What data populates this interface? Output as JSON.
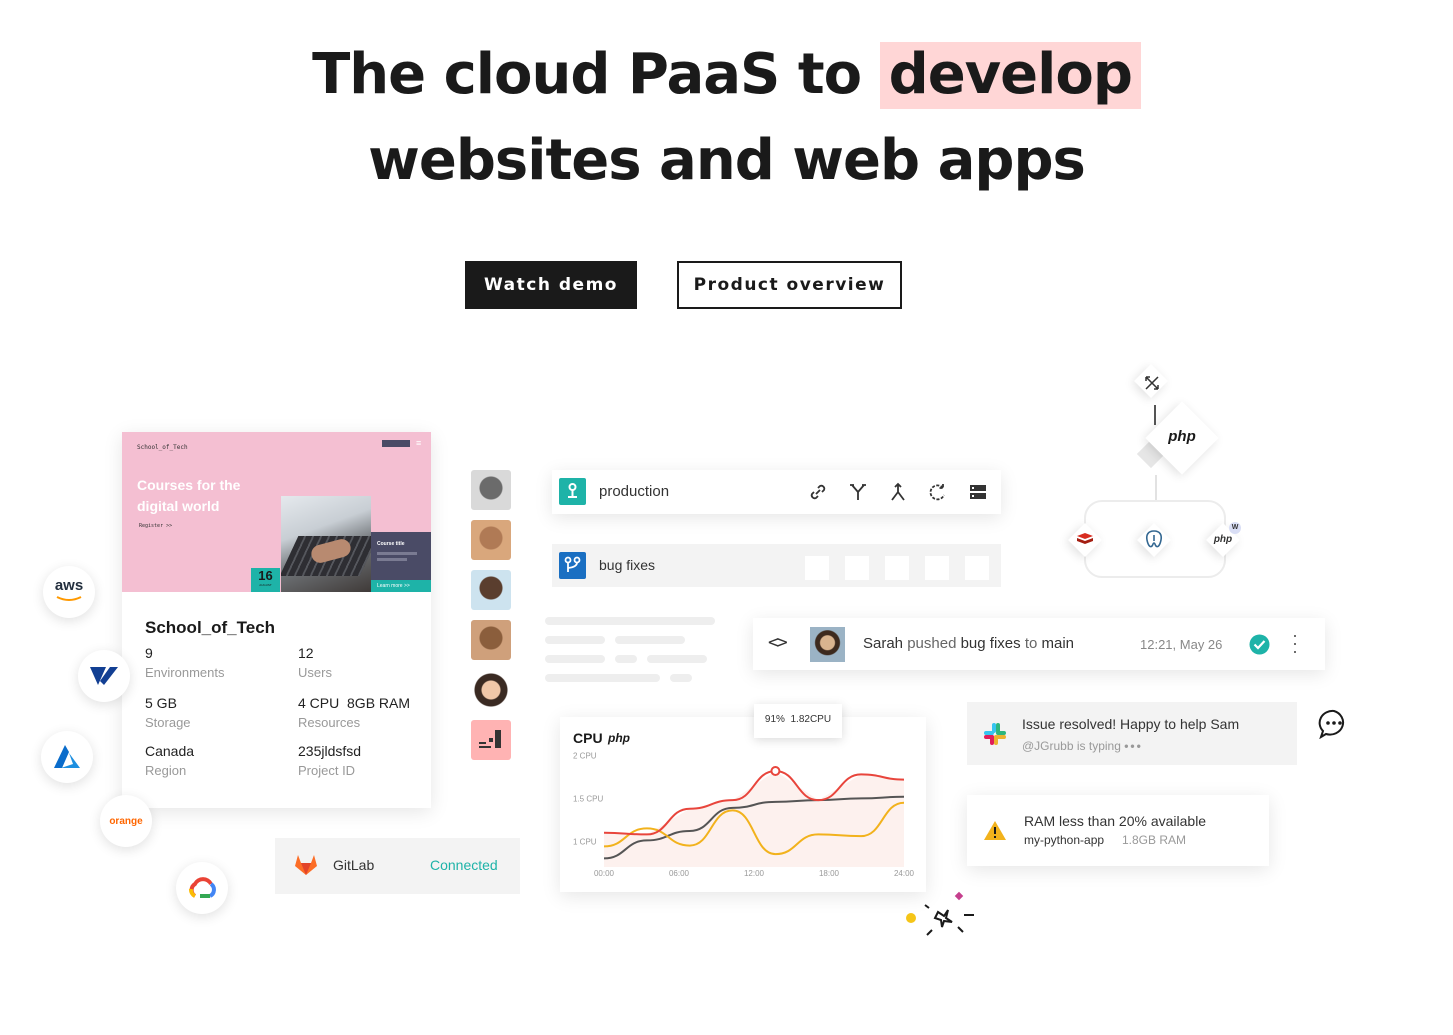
{
  "hero": {
    "line1_prefix": "The cloud PaaS to",
    "line1_highlight": "develop",
    "line2": "websites and web apps"
  },
  "buttons": {
    "watch_demo": "Watch demo",
    "product_overview": "Product overview"
  },
  "project_card": {
    "site_brand": "School_of_Tech",
    "site_headline_1": "Courses for the",
    "site_headline_2": "digital world",
    "site_register": "Register >>",
    "date_day": "16",
    "date_month": "AUGUST",
    "course_title": "Course title",
    "learn_more": "Learn more >>",
    "name": "School_of_Tech",
    "fields": [
      {
        "value": "9",
        "label": "Environments"
      },
      {
        "value": "12",
        "label": "Users"
      },
      {
        "value": "5 GB",
        "label": "Storage"
      },
      {
        "value": "4 CPU  8GB RAM",
        "label": "Resources"
      },
      {
        "value": "Canada",
        "label": "Region"
      },
      {
        "value": "235jldsfsd",
        "label": "Project ID"
      }
    ]
  },
  "clouds": {
    "aws": "aws",
    "orange": "orange"
  },
  "gitlab": {
    "name": "GitLab",
    "status": "Connected"
  },
  "environments": {
    "production": "production",
    "bug_fixes": "bug fixes"
  },
  "activity": {
    "user": "Sarah",
    "action_1": "pushed",
    "branch": "bug fixes",
    "action_2": "to",
    "target": "main",
    "time": "12:21, May 26"
  },
  "cpu_chart": {
    "title": "CPU",
    "runtime": "php",
    "tooltip": "91%  1.82CPU"
  },
  "chart_data": {
    "type": "line",
    "title": "CPU",
    "x": [
      "00:00",
      "06:00",
      "12:00",
      "18:00",
      "24:00"
    ],
    "y_ticks": [
      "2 CPU",
      "1.5 CPU",
      "1 CPU"
    ],
    "ylim": [
      0.7,
      2.1
    ],
    "series": [
      {
        "name": "",
        "color": "#e8453c",
        "values": [
          1.1,
          1.08,
          1.38,
          1.48,
          1.82,
          1.48,
          1.78,
          1.72
        ]
      },
      {
        "name": "",
        "color": "#f2b21c",
        "values": [
          0.94,
          1.15,
          0.95,
          1.36,
          0.85,
          1.08,
          1.06,
          1.45
        ]
      },
      {
        "name": "",
        "color": "#555555",
        "values": [
          0.8,
          1.01,
          1.12,
          1.39,
          1.46,
          1.48,
          1.5,
          1.52
        ]
      }
    ]
  },
  "slack": {
    "message": "Issue resolved! Happy to help Sam",
    "typing": "@JGrubb is typing"
  },
  "alert": {
    "message": "RAM less than 20% available",
    "app": "my-python-app",
    "detail": "1.8GB RAM"
  },
  "services": {
    "php_main": "php",
    "php_small": "php",
    "php_badge": "W"
  },
  "colors": {
    "accent_teal": "#1eb3a8",
    "highlight_pink": "#ffd6d6",
    "card_pink": "#f4bfd2",
    "link_blue": "#1a6fc2"
  }
}
